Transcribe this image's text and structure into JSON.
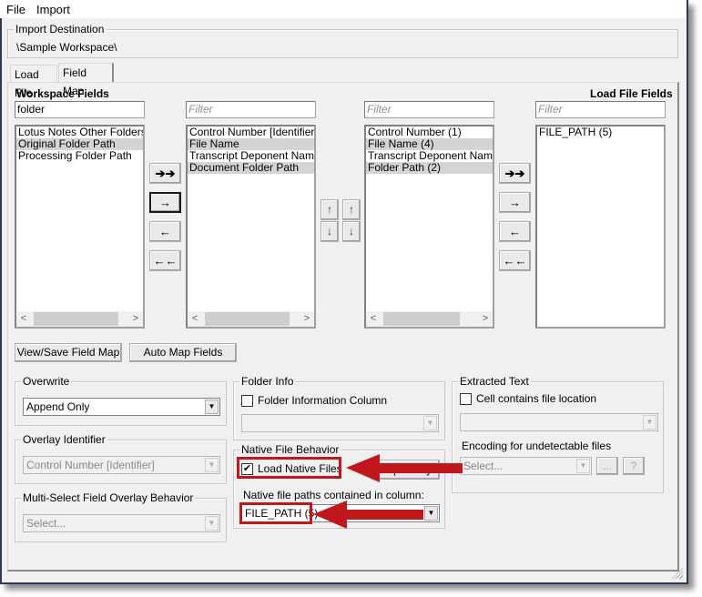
{
  "menubar": {
    "items": [
      "File",
      "Import"
    ]
  },
  "import_destination": {
    "legend": "Import Destination",
    "path": "\\Sample Workspace\\"
  },
  "tabs": [
    {
      "label": "Load File",
      "active": false
    },
    {
      "label": "Field Map",
      "active": true
    }
  ],
  "field_map": {
    "workspace_fields_title": "Workspace Fields",
    "load_file_fields_title": "Load File Fields",
    "workspace_filter": {
      "value": "folder",
      "placeholder": "Filter"
    },
    "mapped_workspace_filter": {
      "value": "",
      "placeholder": "Filter"
    },
    "mapped_load_filter": {
      "value": "",
      "placeholder": "Filter"
    },
    "load_file_filter": {
      "value": "",
      "placeholder": "Filter"
    },
    "workspace_list": [
      {
        "label": "Lotus Notes Other Folders",
        "selected": false
      },
      {
        "label": "Original Folder Path",
        "selected": true
      },
      {
        "label": "Processing Folder Path",
        "selected": false
      }
    ],
    "mapped_workspace_list": [
      {
        "label": "Control Number [Identifier]",
        "selected": false
      },
      {
        "label": "File Name",
        "selected": true
      },
      {
        "label": "Transcript Deponent Name",
        "selected": false
      },
      {
        "label": "Document Folder Path",
        "selected": true
      }
    ],
    "mapped_load_list": [
      {
        "label": "Control Number (1)",
        "selected": false
      },
      {
        "label": "File Name (4)",
        "selected": true
      },
      {
        "label": "Transcript Deponent Name (",
        "selected": false
      },
      {
        "label": "Folder Path (2)",
        "selected": true
      }
    ],
    "load_file_list": [
      {
        "label": "FILE_PATH (5)",
        "selected": false
      }
    ],
    "move_buttons": {
      "all_right": "➔➔",
      "right": "→",
      "left": "←",
      "all_left": "←←"
    },
    "order_buttons": {
      "up": "↑",
      "down": "↓"
    },
    "scroll_left": "<",
    "scroll_right": ">",
    "view_save_label": "View/Save Field Map",
    "auto_map_label": "Auto Map Fields"
  },
  "overwrite": {
    "legend": "Overwrite",
    "value": "Append Only"
  },
  "overlay_identifier": {
    "legend": "Overlay Identifier",
    "value": "Control Number [Identifier]"
  },
  "multi_select": {
    "legend": "Multi-Select Field Overlay Behavior",
    "value": "Select..."
  },
  "folder_info": {
    "legend": "Folder Info",
    "checkbox_label": "Folder Information Column",
    "checked": false,
    "value": ""
  },
  "native_file": {
    "legend": "Native File Behavior",
    "checkbox_label": "Load Native Files",
    "checked": true,
    "check_glyph": "✔",
    "repository_label": "Repository",
    "column_label": "Native file paths contained in column:",
    "column_value": "FILE_PATH (5)"
  },
  "extracted_text": {
    "legend": "Extracted Text",
    "checkbox_label": "Cell contains file location",
    "checked": false,
    "value": "",
    "encoding_label": "Encoding for undetectable files",
    "encoding_value": "Select...",
    "browse_label": "...",
    "help_label": "?"
  },
  "annotation": {
    "color": "#c0171d"
  }
}
